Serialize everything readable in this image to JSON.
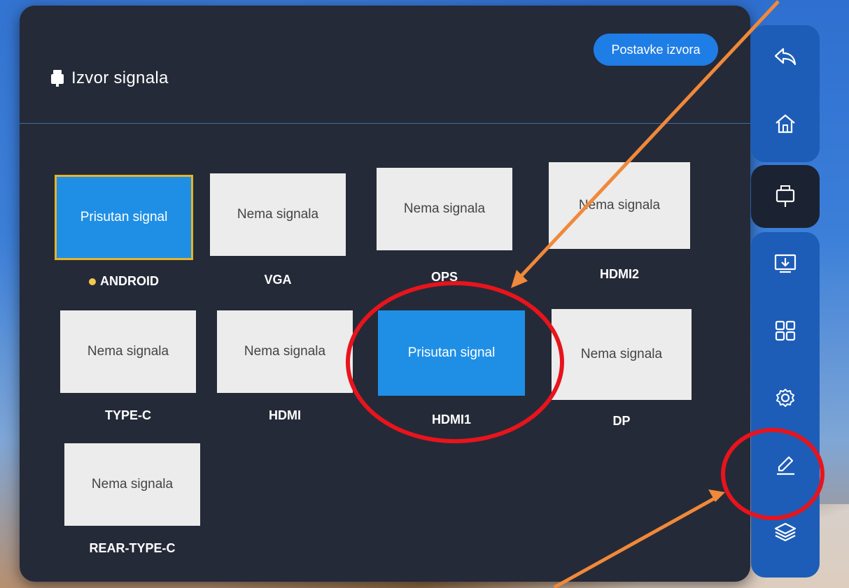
{
  "header": {
    "title": "Izvor signala",
    "settings_button": "Postavke izvora"
  },
  "sources": [
    {
      "name": "ANDROID",
      "status": "Prisutan signal",
      "active": true,
      "current": true
    },
    {
      "name": "VGA",
      "status": "Nema signala",
      "active": false,
      "current": false
    },
    {
      "name": "OPS",
      "status": "Nema signala",
      "active": false,
      "current": false
    },
    {
      "name": "HDMI2",
      "status": "Nema signala",
      "active": false,
      "current": false
    },
    {
      "name": "TYPE-C",
      "status": "Nema signala",
      "active": false,
      "current": false
    },
    {
      "name": "HDMI",
      "status": "Nema signala",
      "active": false,
      "current": false
    },
    {
      "name": "HDMI1",
      "status": "Prisutan signal",
      "active": true,
      "current": false
    },
    {
      "name": "DP",
      "status": "Nema signala",
      "active": false,
      "current": false
    },
    {
      "name": "REAR-TYPE-C",
      "status": "Nema signala",
      "active": false,
      "current": false
    }
  ],
  "sidebar": {
    "items": [
      {
        "icon": "back-icon"
      },
      {
        "icon": "home-icon"
      },
      {
        "icon": "signal-source-icon",
        "selected": true
      },
      {
        "icon": "screen-share-icon"
      },
      {
        "icon": "apps-grid-icon"
      },
      {
        "icon": "settings-gear-icon"
      },
      {
        "icon": "pen-annotate-icon"
      },
      {
        "icon": "layers-icon"
      }
    ]
  },
  "colors": {
    "panel": "#252a38",
    "accent_blue": "#1f8fe6",
    "highlight_red": "#e8141c",
    "arrow_orange": "#f0893a",
    "selected_border": "#e2b42e"
  }
}
